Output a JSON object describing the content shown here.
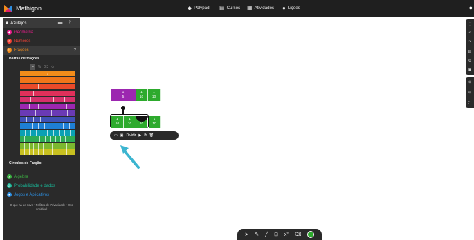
{
  "topbar": {
    "brand": "Mathigon",
    "nav": [
      {
        "icon": "polygon-icon",
        "glyph": "◆",
        "label": "Polypad"
      },
      {
        "icon": "courses-icon",
        "glyph": "▤",
        "label": "Cursos"
      },
      {
        "icon": "activities-icon",
        "glyph": "▦",
        "label": "Atividades"
      },
      {
        "icon": "lessons-icon",
        "glyph": "●",
        "label": "Lições"
      }
    ]
  },
  "sidebar": {
    "tab_label": "Azulejos",
    "categories_top": [
      {
        "label": "Geometria",
        "color": "#e91e8c",
        "active": false
      },
      {
        "label": "Números",
        "color": "#f44336",
        "active": false
      },
      {
        "label": "Frações",
        "color": "#f28c1a",
        "active": true
      }
    ],
    "fraction_bars_title": "Barras de frações",
    "fraction_tools": [
      "÷",
      "%",
      "0.3",
      "⊙"
    ],
    "fraction_circles_title": "Círculos de Fração",
    "categories_bottom": [
      {
        "label": "Álgebra",
        "color": "#3cb043"
      },
      {
        "label": "Probabilidade e dados",
        "color": "#1ab394"
      },
      {
        "label": "Jogos e Aplicativos",
        "color": "#2d8fe0"
      }
    ],
    "footer": "O que há de novo • Política de Privacidade • Uso aceitável"
  },
  "fraction_bars": [
    {
      "n": 1,
      "color": "#f28c1a",
      "label": "1"
    },
    {
      "n": 2,
      "color": "#f0761a",
      "label": ""
    },
    {
      "n": 3,
      "color": "#ea4a2a",
      "label": ""
    },
    {
      "n": 4,
      "color": "#e0305a",
      "label": ""
    },
    {
      "n": 5,
      "color": "#d6306a",
      "label": ""
    },
    {
      "n": 6,
      "color": "#9c27b0",
      "label": ""
    },
    {
      "n": 7,
      "color": "#6a3ab5",
      "label": ""
    },
    {
      "n": 8,
      "color": "#3f51b5",
      "label": ""
    },
    {
      "n": 9,
      "color": "#1e7fd4",
      "label": ""
    },
    {
      "n": 10,
      "color": "#0aa0b4",
      "label": ""
    },
    {
      "n": 11,
      "color": "#2daa55",
      "label": ""
    },
    {
      "n": 12,
      "color": "#7cb82f",
      "label": ""
    },
    {
      "n": 12,
      "color": "#c8c020",
      "label": ""
    }
  ],
  "canvas": {
    "row1": [
      {
        "num": "1",
        "den": "5",
        "color": "purple"
      },
      {
        "num": "1",
        "den": "10",
        "color": "green"
      },
      {
        "num": "1",
        "den": "10",
        "color": "green"
      }
    ],
    "row2": [
      {
        "num": "1",
        "den": "10",
        "color": "green"
      },
      {
        "num": "1",
        "den": "10",
        "color": "green"
      },
      {
        "num": "1",
        "den": "10",
        "color": "green"
      },
      {
        "num": "1",
        "den": "10",
        "color": "green"
      }
    ],
    "toolbar": {
      "divide_label": "Dividir"
    }
  },
  "bottom_tools": [
    "select-arrow-icon",
    "pen-icon",
    "line-icon",
    "text-box-icon",
    "equation-icon",
    "eraser-icon"
  ],
  "active_color": "#2daa2d"
}
